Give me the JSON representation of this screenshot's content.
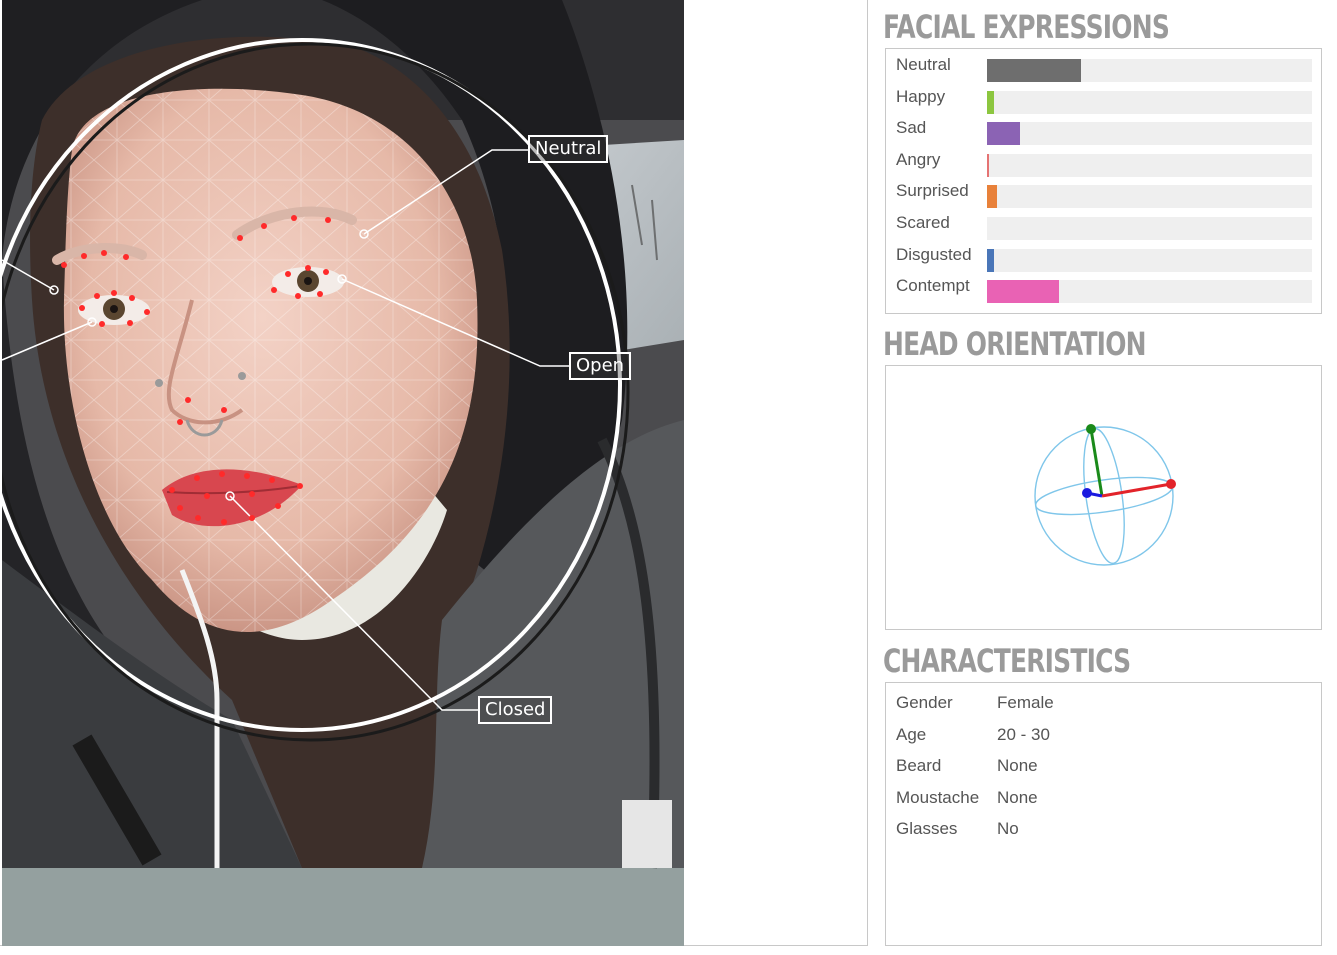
{
  "photo": {
    "labels": {
      "brow": "Neutral",
      "eye": "Open",
      "mouth": "Closed"
    },
    "colors": {
      "landmark": "#ff2a2a",
      "mesh": "#ffffff",
      "background": "#94a09f"
    }
  },
  "facial_expressions": {
    "title": "FACIAL EXPRESSIONS",
    "items": [
      {
        "label": "Neutral",
        "value": 0.29,
        "color": "#6e6e6e"
      },
      {
        "label": "Happy",
        "value": 0.02,
        "color": "#8cc63f"
      },
      {
        "label": "Sad",
        "value": 0.1,
        "color": "#8b63b4"
      },
      {
        "label": "Angry",
        "value": 0.004,
        "color": "#e57373"
      },
      {
        "label": "Surprised",
        "value": 0.03,
        "color": "#e8813a"
      },
      {
        "label": "Scared",
        "value": 0.0,
        "color": "#999999"
      },
      {
        "label": "Disgusted",
        "value": 0.02,
        "color": "#4a76b8"
      },
      {
        "label": "Contempt",
        "value": 0.22,
        "color": "#e962b4"
      }
    ]
  },
  "head_orientation": {
    "title": "HEAD ORIENTATION",
    "colors": {
      "sphere": "#7fc6ea",
      "x_axis": "#e2232a",
      "y_axis": "#1a8a1a",
      "z_axis": "#1a1ae0"
    }
  },
  "characteristics": {
    "title": "CHARACTERISTICS",
    "rows": [
      {
        "key": "Gender",
        "value": "Female"
      },
      {
        "key": "Age",
        "value": "20 - 30"
      },
      {
        "key": "Beard",
        "value": "None"
      },
      {
        "key": "Moustache",
        "value": "None"
      },
      {
        "key": "Glasses",
        "value": "No"
      }
    ]
  }
}
